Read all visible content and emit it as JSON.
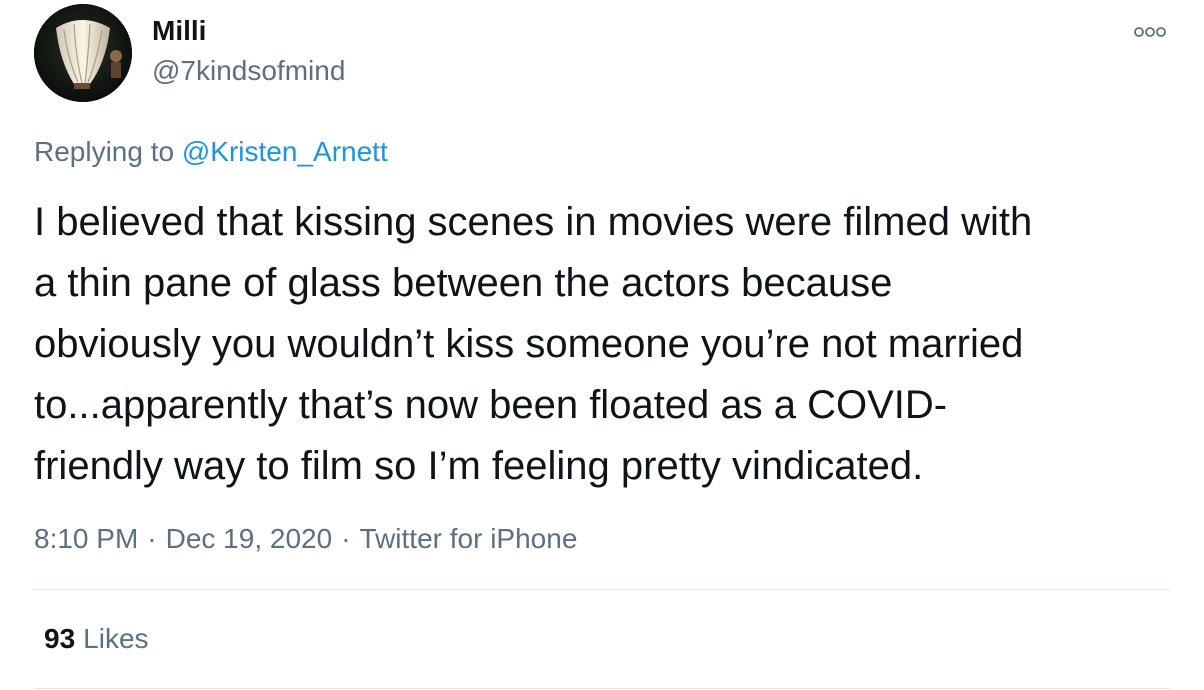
{
  "author": {
    "display_name": "Milli",
    "handle": "@7kindsofmind",
    "avatar_icon": "lantern-photo-avatar"
  },
  "more_icon": "more-options-icon",
  "reply_context": {
    "prefix": "Replying to ",
    "mention": "@Kristen_Arnett"
  },
  "tweet": {
    "text": "I believed that kissing scenes in movies were filmed with\na thin pane of glass between the actors because\nobviously you wouldn’t kiss someone you’re not married\nto...apparently that’s now been floated as a COVID-\nfriendly way to film so I’m feeling pretty vindicated."
  },
  "meta": {
    "time": "8:10 PM",
    "separator": "·",
    "date": "Dec 19, 2020",
    "source": "Twitter for iPhone"
  },
  "stats": {
    "likes_count": "93",
    "likes_label": "Likes"
  },
  "colors": {
    "text": "#0f1419",
    "secondary": "#5b7083",
    "link": "#1b95e0",
    "divider": "#e1e8ed"
  }
}
